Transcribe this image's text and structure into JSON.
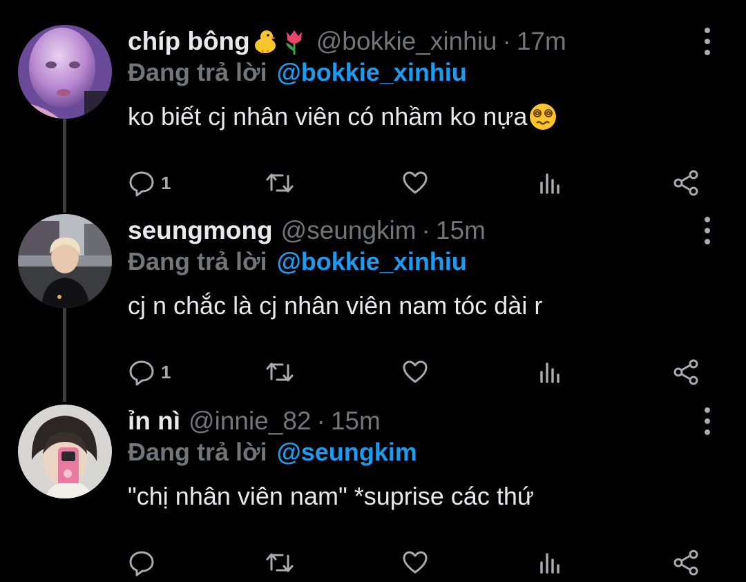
{
  "tweets": [
    {
      "display_name": "chíp bông",
      "name_emojis": [
        "chick-emoji",
        "tulip-emoji"
      ],
      "handle": "@bokkie_xinhiu",
      "separator": "·",
      "time": "17m",
      "replying_label": "Đang trả lời",
      "replying_to": "@bokkie_xinhiu",
      "text": "ko biết cj nhân viên có nhầm ko nựa",
      "text_emoji": "dizzy-face-emoji",
      "reply_count": "1",
      "avatar": "avatar-face-mask"
    },
    {
      "display_name": "seungmong",
      "handle": "@seungkim",
      "separator": "·",
      "time": "15m",
      "replying_label": "Đang trả lời",
      "replying_to": "@bokkie_xinhiu",
      "text": "cj n chắc là cj nhân viên nam tóc dài r",
      "reply_count": "1",
      "avatar": "avatar-street-photo"
    },
    {
      "display_name": "ỉn nì",
      "handle": "@innie_82",
      "separator": "·",
      "time": "15m",
      "replying_label": "Đang trả lời",
      "replying_to": "@seungkim",
      "text": "\"chị nhân viên nam\" *suprise các thứ",
      "reply_count": "",
      "avatar": "avatar-mirror-selfie"
    }
  ],
  "icons": [
    "reply-icon",
    "retweet-icon",
    "like-icon",
    "analytics-icon",
    "share-icon",
    "more-options-icon"
  ],
  "colors": {
    "background": "#000000",
    "text": "#e7e9ea",
    "muted": "#71767b",
    "link": "#1d9bf0",
    "thread_line": "#3a3c3f"
  }
}
